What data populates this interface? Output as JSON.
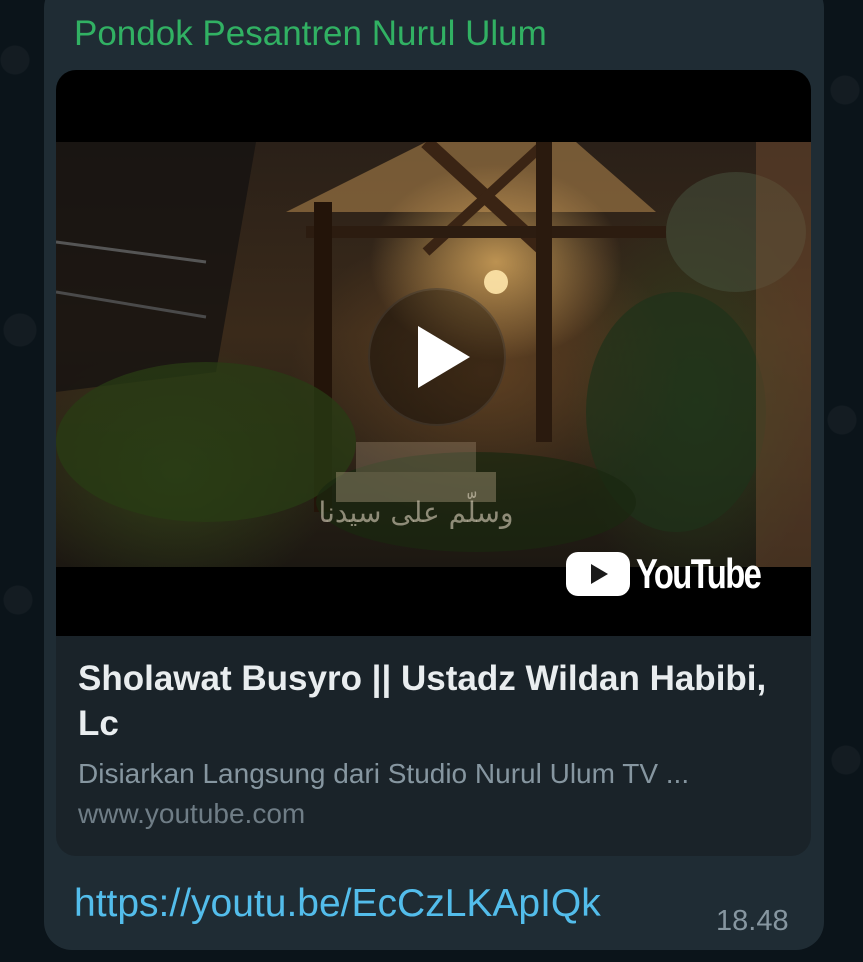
{
  "message": {
    "sender_name": "Pondok Pesantren Nurul Ulum",
    "link_url": "https://youtu.be/EcCzLKApIQk",
    "timestamp": "18.48"
  },
  "link_preview": {
    "title": "Sholawat Busyro || Ustadz Wildan Habibi, Lc",
    "description": "Disiarkan Langsung dari Studio Nurul Ulum TV ...",
    "domain": "www.youtube.com",
    "thumbnail": {
      "watermark": "YouTube",
      "overlay_caption": "وسلّم على سيدنا",
      "play_icon": "play-icon"
    }
  },
  "colors": {
    "chat_background": "#0b141a",
    "bubble": "#1f2c34",
    "preview_card": "#1a2329",
    "sender_name": "#31b163",
    "link": "#53bdeb",
    "title_text": "#e9edef",
    "secondary_text": "#8696a0"
  }
}
